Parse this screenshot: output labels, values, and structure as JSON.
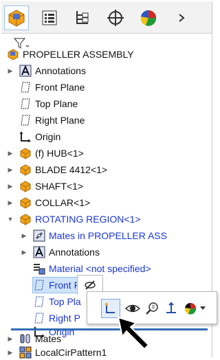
{
  "tabs": [
    {
      "name": "feature-manager",
      "icon": "feature-manager-icon"
    },
    {
      "name": "property-manager",
      "icon": "property-manager-icon"
    },
    {
      "name": "configuration-manager",
      "icon": "configuration-manager-icon"
    },
    {
      "name": "dim-xpert-manager",
      "icon": "crosshair-icon"
    },
    {
      "name": "display-manager",
      "icon": "color-sphere-icon"
    },
    {
      "name": "more",
      "icon": "chevron-right-icon"
    }
  ],
  "tree": {
    "root": "PROPELLER ASSEMBLY",
    "items": [
      {
        "label": "Annotations"
      },
      {
        "label": "Front Plane"
      },
      {
        "label": "Top Plane"
      },
      {
        "label": "Right Plane"
      },
      {
        "label": "Origin"
      },
      {
        "label": "(f) HUB<1>"
      },
      {
        "label": "BLADE 4412<1>"
      },
      {
        "label": "SHAFT<1>"
      },
      {
        "label": "COLLAR<1>"
      },
      {
        "label": "ROTATING REGION<1>"
      },
      {
        "label": "Mates in PROPELLER ASS"
      },
      {
        "label": "Annotations"
      },
      {
        "label": "Material <not specified>"
      },
      {
        "label": "Front Plane"
      },
      {
        "label": "Top Pla"
      },
      {
        "label": "Right P"
      },
      {
        "label": "Origin"
      },
      {
        "label": "Mates"
      },
      {
        "label": "LocalCirPattern1"
      }
    ]
  },
  "popup": {
    "tools": [
      "hide-icon",
      "sketch-icon",
      "view-icon",
      "zoom-to-selection-icon",
      "normal-to-icon",
      "appearance-icon"
    ]
  },
  "colors": {
    "accent": "#1a35d6",
    "selection": "#cfe3fb",
    "divider": "#2f6db5"
  }
}
